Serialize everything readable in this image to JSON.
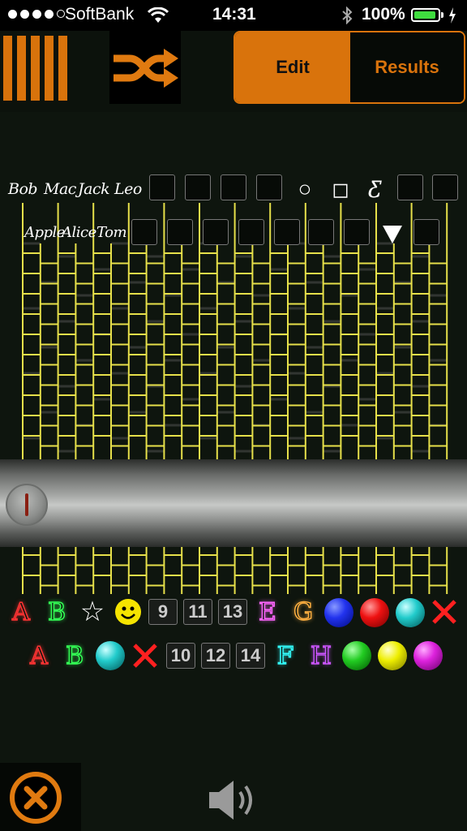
{
  "status_bar": {
    "carrier": "SoftBank",
    "time": "14:31",
    "battery": "100%"
  },
  "toolbar": {
    "segments": {
      "edit": "Edit",
      "results": "Results"
    },
    "active_segment": "Edit"
  },
  "top_names": [
    "Bob",
    "Mac",
    "Jack",
    "Leo"
  ],
  "second_names": [
    "Apple",
    "Alice",
    "Tom"
  ],
  "top_marks": [
    "○",
    "◻",
    "Ƹ"
  ],
  "results_row1": [
    "A",
    "B",
    "☆",
    "☺",
    "9",
    "11",
    "13",
    "E",
    "G",
    "blue",
    "red",
    "cyan",
    "✕"
  ],
  "results_row2": [
    "A",
    "B",
    "cyan",
    "✕",
    "10",
    "12",
    "14",
    "F",
    "H",
    "green",
    "yellow",
    "magenta"
  ],
  "colors": {
    "accent": "#d9730c",
    "ladder": "#e6e04a",
    "battery": "#3fdc3f"
  }
}
